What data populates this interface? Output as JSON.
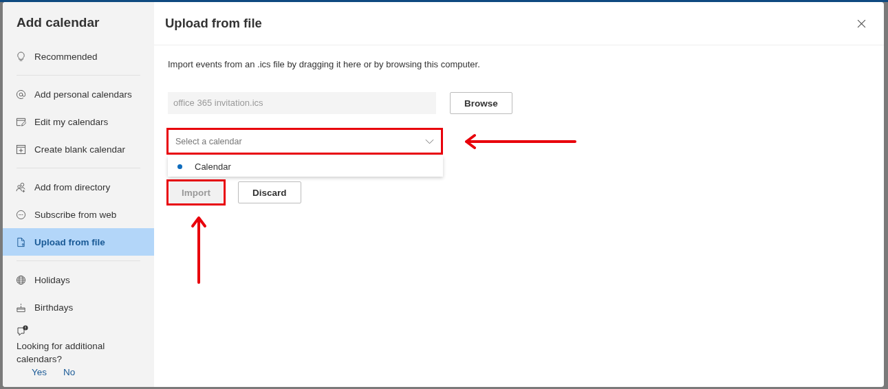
{
  "sidebar": {
    "title": "Add calendar",
    "groups": [
      {
        "items": [
          {
            "label": "Recommended",
            "kind": "bulb",
            "selected": false
          }
        ]
      },
      {
        "items": [
          {
            "label": "Add personal calendars",
            "kind": "at",
            "selected": false
          },
          {
            "label": "Edit my calendars",
            "kind": "edit",
            "selected": false
          },
          {
            "label": "Create blank calendar",
            "kind": "plus",
            "selected": false
          }
        ]
      },
      {
        "items": [
          {
            "label": "Add from directory",
            "kind": "people",
            "selected": false
          },
          {
            "label": "Subscribe from web",
            "kind": "dots",
            "selected": false
          },
          {
            "label": "Upload from file",
            "kind": "file",
            "selected": true
          }
        ]
      },
      {
        "items": [
          {
            "label": "Holidays",
            "kind": "globe",
            "selected": false
          },
          {
            "label": "Birthdays",
            "kind": "cake",
            "selected": false
          }
        ]
      }
    ],
    "feedback": {
      "question": "Looking for additional calendars?",
      "answers": [
        "Yes",
        "No"
      ]
    }
  },
  "panel": {
    "title": "Upload from file",
    "description": "Import events from an .ics file by dragging it here or by browsing this computer.",
    "file_field": {
      "value": "office 365 invitation.ics",
      "disabled": true
    },
    "browse_button": "Browse",
    "calendar_select": {
      "placeholder": "Select a calendar",
      "expanded": true,
      "options": [
        {
          "label": "Calendar",
          "color": "#0f6cbd"
        }
      ]
    },
    "buttons": [
      {
        "label": "Import",
        "disabled": true
      },
      {
        "label": "Discard",
        "disabled": false
      }
    ]
  }
}
